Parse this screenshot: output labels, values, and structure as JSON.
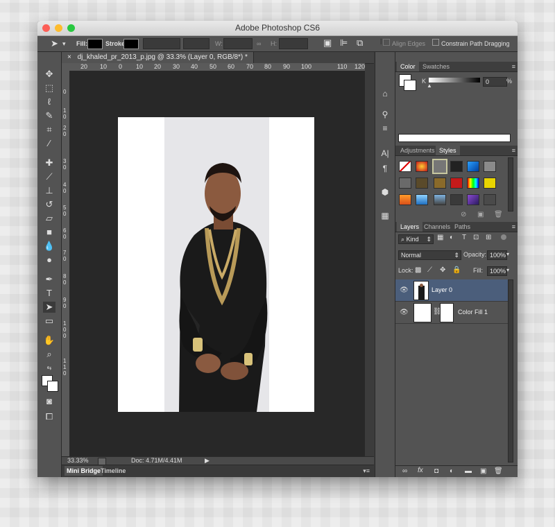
{
  "window": {
    "title": "Adobe Photoshop CS6"
  },
  "options_bar": {
    "fill_label": "Fill:",
    "stroke_label": "Stroke:",
    "w_label": "W:",
    "h_label": "H:",
    "align_edges": "Align Edges",
    "constrain_path": "Constrain Path Dragging"
  },
  "document": {
    "tab_title": "dj_khaled_pr_2013_p.jpg @ 33.3% (Layer 0, RGB/8*) *",
    "close_glyph": "×",
    "ruler_h_labels": [
      "20",
      "10",
      "0",
      "10",
      "20",
      "30",
      "40",
      "50",
      "60",
      "70",
      "80",
      "90",
      "100",
      "110",
      "120"
    ],
    "ruler_v_labels": [
      "0",
      "1",
      "0",
      "2",
      "0",
      "3",
      "0",
      "4",
      "0",
      "5",
      "0",
      "6",
      "0",
      "7",
      "0",
      "8",
      "0",
      "9",
      "0",
      "1",
      "0",
      "0",
      "1",
      "1",
      "0"
    ]
  },
  "status": {
    "zoom": "33.33%",
    "doc": "Doc: 4.71M/4.41M"
  },
  "bottom_tabs": [
    "Mini Bridge",
    "Timeline"
  ],
  "color_panel": {
    "tabs": [
      "Color",
      "Swatches"
    ],
    "channel": "K",
    "value": "0",
    "unit": "%"
  },
  "styles_panel": {
    "tabs": [
      "Adjustments",
      "Styles"
    ]
  },
  "layers_panel": {
    "tabs": [
      "Layers",
      "Channels",
      "Paths"
    ],
    "kind": "Kind",
    "blend_mode": "Normal",
    "opacity_label": "Opacity:",
    "opacity": "100%",
    "lock_label": "Lock:",
    "fill_label": "Fill:",
    "fill": "100%",
    "layers": [
      {
        "name": "Layer 0",
        "selected": true
      },
      {
        "name": "Color Fill 1",
        "selected": false
      }
    ]
  },
  "colors": {
    "accent_selected": "#4b5e7b",
    "traffic_red": "#fc5f57",
    "traffic_yellow": "#fdbc2e",
    "traffic_green": "#28c840"
  }
}
